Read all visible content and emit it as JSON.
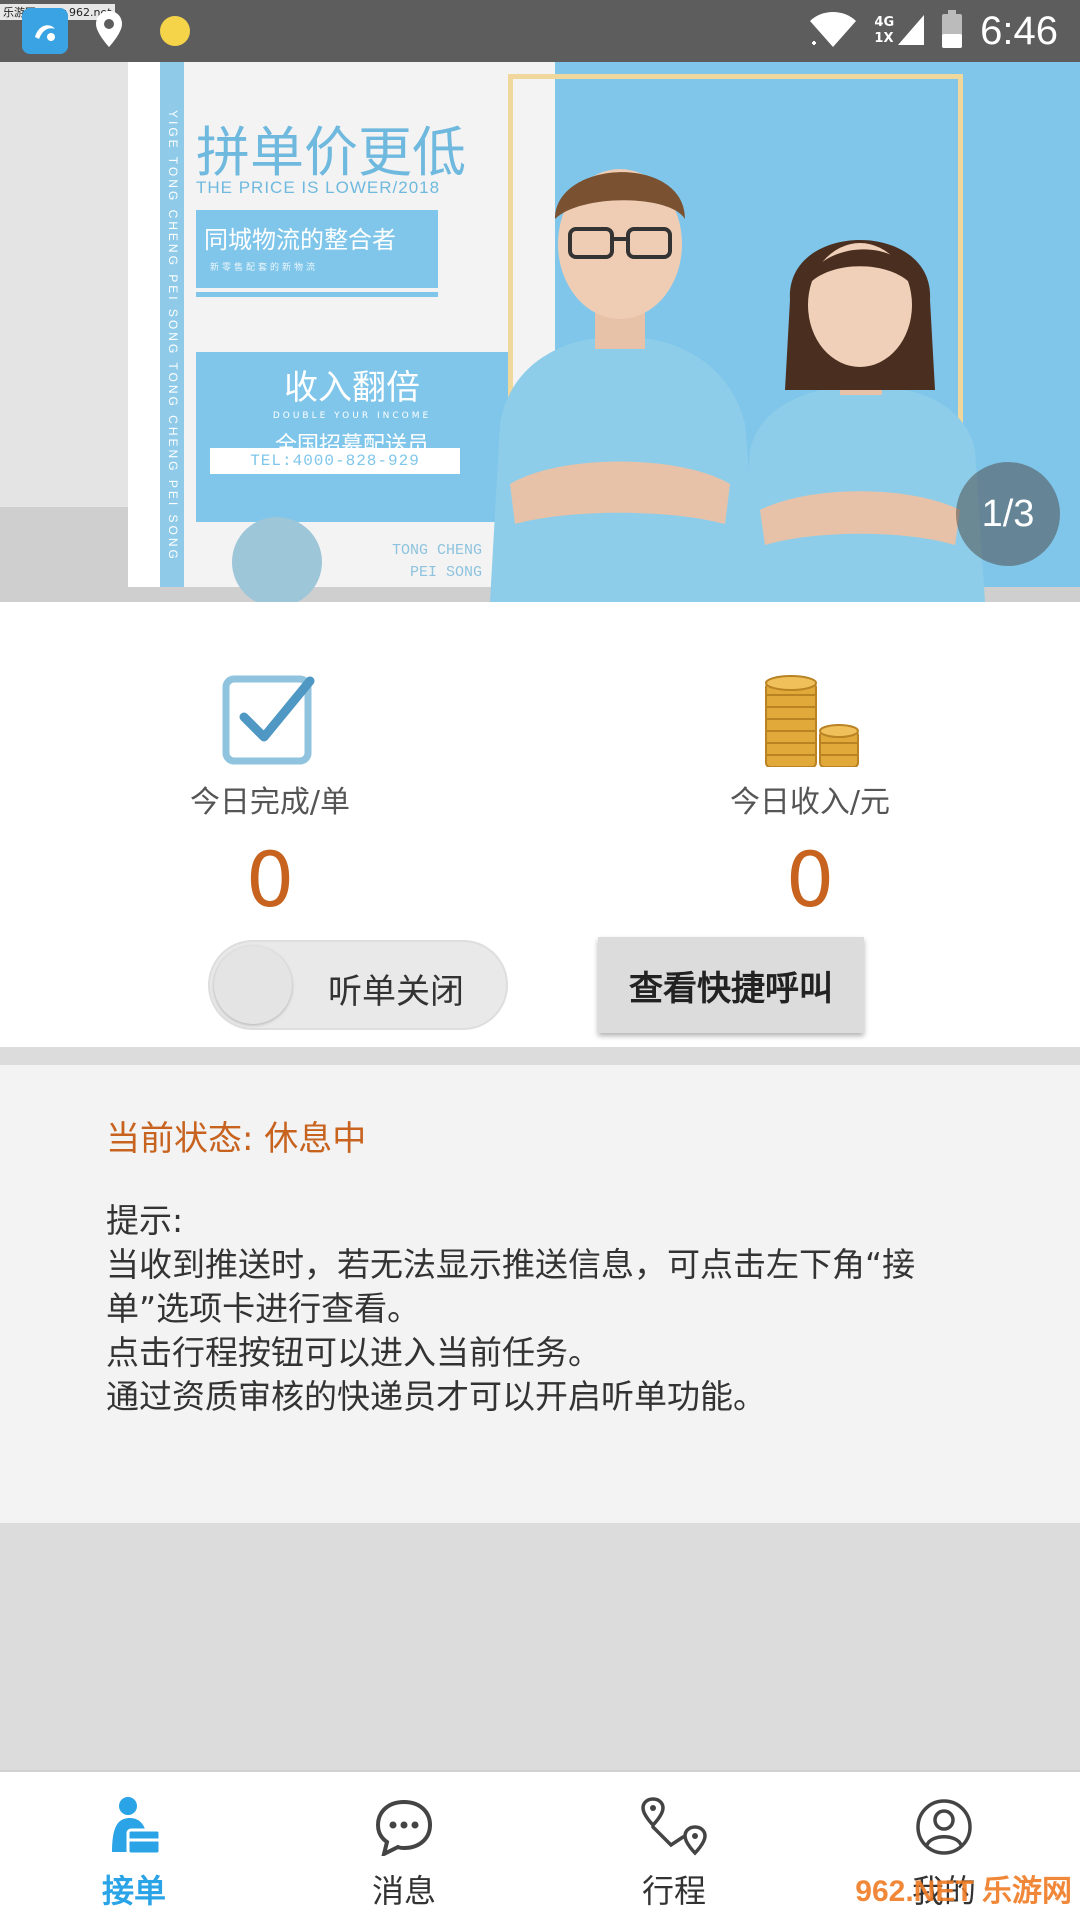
{
  "status_bar": {
    "watermark": "乐游网 www.962.net",
    "network_top": "4G",
    "network_bottom": "1X",
    "time": "6:46"
  },
  "banner": {
    "headline": "拼单价更低",
    "subheadline": "THE PRICE IS LOWER/2018",
    "box1_title": "同城物流的整合者",
    "box1_sub": "新零售配套的新物流",
    "box2_title": "收入翻倍",
    "box2_sub": "DOUBLE YOUR INCOME",
    "box2_recruit": "全国招募配送员",
    "tel": "TEL:4000-828-929",
    "vertical_text": "YIGE TONG CHENG PEI SONG TONG CHENG PEI SONG",
    "corner_text_1": "TONG CHENG",
    "corner_text_2": "PEI SONG",
    "pager": "1/3"
  },
  "stats": {
    "completed_label": "今日完成/单",
    "completed_value": "0",
    "income_label": "今日收入/元",
    "income_value": "0"
  },
  "controls": {
    "listen_toggle_label": "听单关闭",
    "listen_toggle_on": false,
    "quick_call_button": "查看快捷呼叫"
  },
  "status_panel": {
    "current_state": "当前状态: 休息中",
    "tips_title": "提示:",
    "tip_1": "当收到推送时，若无法显示推送信息，可点击左下角“接单”选项卡进行查看。",
    "tip_2": "点击行程按钮可以进入当前任务。",
    "tip_3": "通过资质审核的快递员才可以开启听单功能。"
  },
  "bottom_nav": {
    "items": [
      {
        "label": "接单",
        "icon": "courier-package-icon",
        "active": true
      },
      {
        "label": "消息",
        "icon": "chat-bubble-icon",
        "active": false
      },
      {
        "label": "行程",
        "icon": "route-icon",
        "active": false
      },
      {
        "label": "我的",
        "icon": "user-profile-icon",
        "active": false
      }
    ],
    "watermark": "962.NET 乐游网"
  },
  "colors": {
    "accent_blue": "#2aa4e6",
    "accent_orange": "#c7631f",
    "status_bar": "#5d5d5d"
  }
}
